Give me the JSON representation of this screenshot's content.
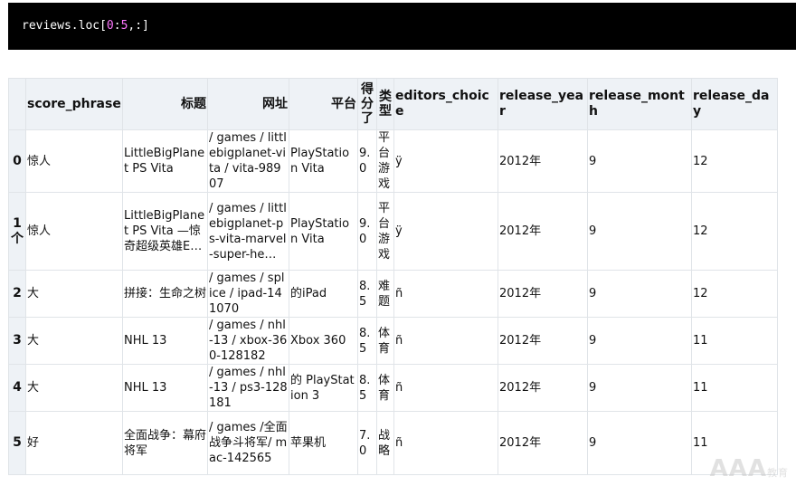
{
  "code_cell": {
    "prefix": "reviews.loc[",
    "start": "0",
    "colon": ":",
    "end": "5",
    "suffix": ",:]"
  },
  "table": {
    "columns": [
      "",
      "score_phrase",
      "标题",
      "网址",
      "平台",
      "得分了",
      "类型",
      "editors_choice",
      "release_year",
      "release_month",
      "release_day"
    ],
    "rows": [
      [
        "0",
        "惊人",
        "LittleBigPlanet PS Vita",
        "/ games / littlebigplanet-vita / vita-98907",
        "PlayStation Vita",
        "9.0",
        "平台游戏",
        "ÿ",
        "2012年",
        "9",
        "12"
      ],
      [
        "1个",
        "惊人",
        "LittleBigPlanet PS Vita —惊奇超级英雄E…",
        "/ games / littlebigplanet-ps-vita-marvel-super-he…",
        "PlayStation Vita",
        "9.0",
        "平台游戏",
        "ÿ",
        "2012年",
        "9",
        "12"
      ],
      [
        "2",
        "大",
        "拼接：生命之树",
        "/ games / splice / ipad-141070",
        "的iPad",
        "8.5",
        "难题",
        "ñ",
        "2012年",
        "9",
        "12"
      ],
      [
        "3",
        "大",
        "NHL 13",
        "/ games / nhl-13 / xbox-360-128182",
        "Xbox 360",
        "8.5",
        "体育",
        "ñ",
        "2012年",
        "9",
        "11"
      ],
      [
        "4",
        "大",
        "NHL 13",
        "/ games / nhl-13 / ps3-128181",
        "的 PlayStation 3",
        "8.5",
        "体育",
        "ñ",
        "2012年",
        "9",
        "11"
      ],
      [
        "5",
        "好",
        "全面战争：幕府将军",
        "/ games /全面战争斗将军/ mac-142565",
        "苹果机",
        "7.0",
        "战略",
        "ñ",
        "2012年",
        "9",
        "11"
      ]
    ]
  },
  "watermark": {
    "main": "AAA",
    "sub": "教育"
  }
}
